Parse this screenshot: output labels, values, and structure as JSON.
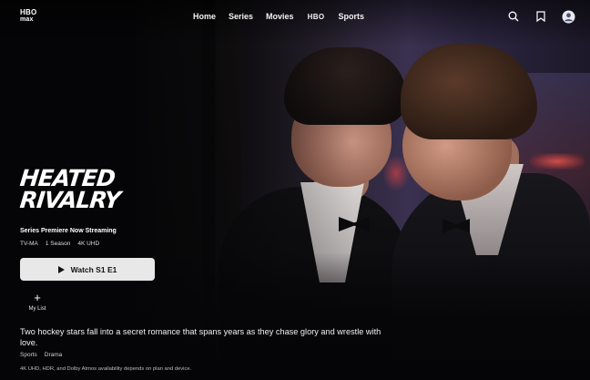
{
  "brand": {
    "logo_line1": "HBO",
    "logo_line2": "max"
  },
  "nav": {
    "links": [
      "Home",
      "Series",
      "Movies",
      "HBO",
      "Sports"
    ],
    "icons": [
      "search-icon",
      "bookmark-icon",
      "profile-icon"
    ]
  },
  "show": {
    "title_line1": "HEATED",
    "title_line2": "RIVALRY",
    "premiere": "Series Premiere Now Streaming",
    "meta": [
      "TV-MA",
      "1 Season",
      "4K UHD"
    ],
    "watch_label": "Watch S1 E1",
    "mylist_label": "My List",
    "description": "Two hockey stars fall into a secret romance that spans years as they chase glory and wrestle with love.",
    "genres": [
      "Sports",
      "Drama"
    ],
    "availability": "4K UHD, HDR, and Dolby Atmos availability depends on plan and device."
  },
  "colors": {
    "background": "#050507",
    "button_bg": "#e8e8e8",
    "button_text": "#111111",
    "text": "#ffffff"
  }
}
